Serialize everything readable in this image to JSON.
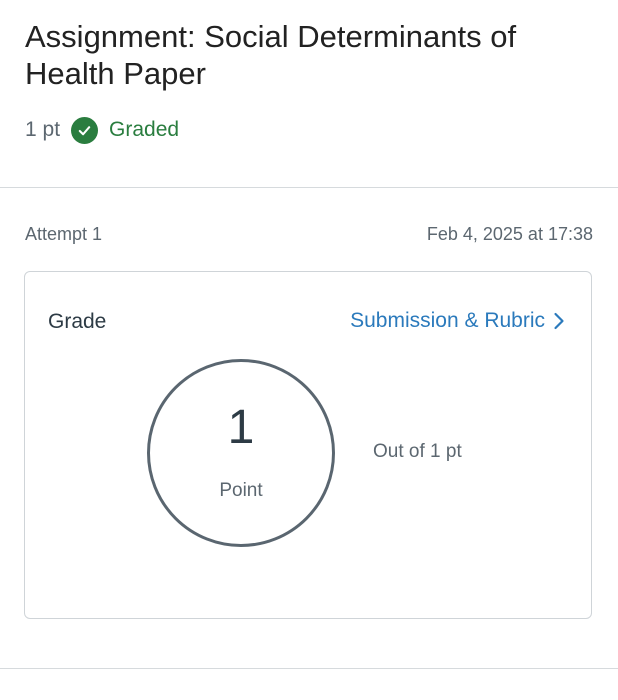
{
  "assignment": {
    "title": "Assignment: Social Determinants of Health Paper",
    "points_label": "1 pt",
    "status": "Graded"
  },
  "attempt": {
    "label": "Attempt 1",
    "submitted_at": "Feb 4, 2025 at 17:38"
  },
  "grade_card": {
    "heading": "Grade",
    "link_label": "Submission & Rubric",
    "score_value": "1",
    "score_unit": "Point",
    "out_of": "Out of 1 pt"
  },
  "colors": {
    "status_green": "#2a7d3f",
    "link_blue": "#2b7abc"
  },
  "icons": {
    "status": "check-circle-icon",
    "link": "chevron-right-icon"
  }
}
